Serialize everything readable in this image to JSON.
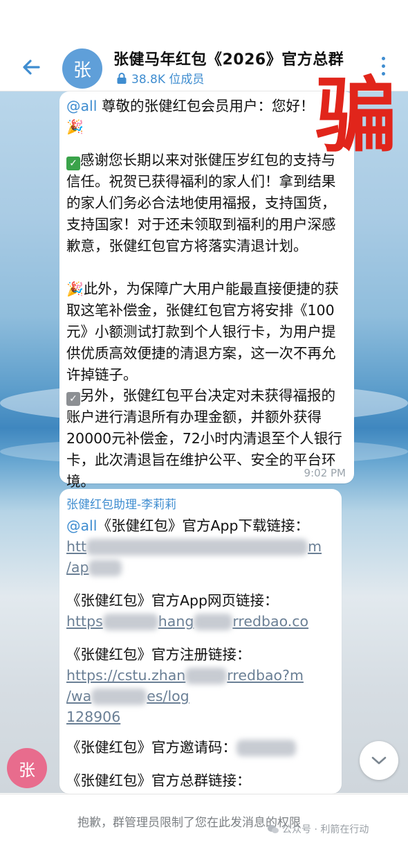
{
  "header": {
    "avatar_char": "张",
    "title": "张健马年红包《2026》官方总群",
    "members": "38.8K 位成员"
  },
  "overlay": {
    "scam_char": "骗"
  },
  "message1": {
    "line1_mention": "@all",
    "line1_text": " 尊敬的张健红包会员用户：您好！",
    "para1": "感谢您长期以来对张健压岁红包的支持与信任。祝贺已获得福利的家人们！拿到结果的家人们务必合法地使用福报，支持国货，支持国家！对于还未领取到福利的用户深感歉意，张健红包官方将落实清退计划。",
    "para2": "此外，为保障广大用户能最直接便捷的获取这笔补偿金，张健红包官方将安排《100元》小额测试打款到个人银行卡，为用户提供优质高效便捷的清退方案，这一次不再允许掉链子。",
    "para3": "另外，张健红包平台决定对未获得福报的账户进行清退所有办理金额，并额外获得20000元补偿金，72小时内清退至个人银行卡，此次清退旨在维护公平、安全的平台环境。",
    "time": "9:02 PM"
  },
  "message2": {
    "sender": "张健红包助理-李莉莉",
    "line1_mention": "@all",
    "line1_text": "《张健红包》官方App下载链接：",
    "link1a": "htt",
    "link1a_end": "m",
    "link1b": "/ap",
    "label2": "《张健红包》官方App网页链接：",
    "link2a": "https",
    "link2b": "hang",
    "link2c": "rredbao.co",
    "label3": "《张健红包》官方注册链接：",
    "link3a": "https://cstu.zhan",
    "link3b": "rredbao?",
    "link3c": "m",
    "link3d": "/wa",
    "link3e": "es/log",
    "link3f": "128906",
    "label4": "《张健红包》官方邀请码：",
    "label5": "《张健红包》官方总群链接："
  },
  "sidebar_avatar": {
    "char": "张"
  },
  "bottom": {
    "restriction": "抱歉，群管理员限制了您在此发消息的权限",
    "watermark": "公众号 · 利箭在行动"
  }
}
